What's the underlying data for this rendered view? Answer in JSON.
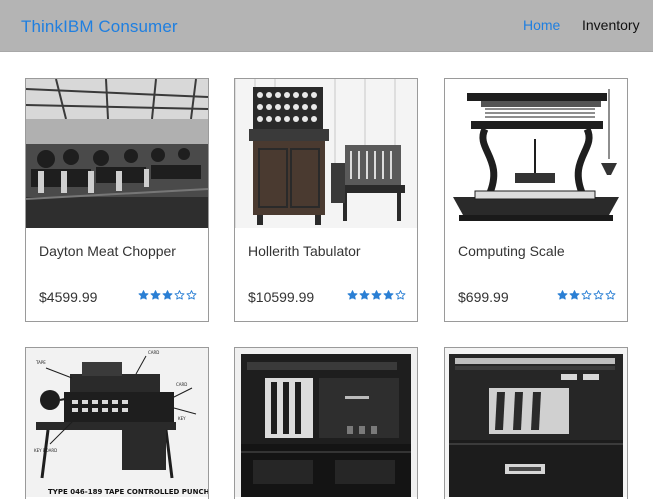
{
  "header": {
    "brand": "ThinkIBM Consumer",
    "nav": [
      {
        "label": "Home",
        "active": true
      },
      {
        "label": "Inventory",
        "active": false
      }
    ]
  },
  "colors": {
    "accent": "#1f7fe0",
    "navbar_bg": "#b4b4b4",
    "star": "#2a7fd4"
  },
  "products": [
    {
      "name": "Dayton Meat Chopper",
      "price": "$4599.99",
      "rating": 3,
      "max_rating": 5,
      "image": "factory-floor-photo"
    },
    {
      "name": "Hollerith Tabulator",
      "price": "$10599.99",
      "rating": 4,
      "max_rating": 5,
      "image": "tabulator-machine-photo"
    },
    {
      "name": "Computing Scale",
      "price": "$699.99",
      "rating": 2,
      "max_rating": 5,
      "image": "computing-scale-illustration"
    },
    {
      "name": "",
      "price": "",
      "rating": 0,
      "max_rating": 5,
      "image": "tape-controlled-punch-photo"
    },
    {
      "name": "",
      "price": "",
      "rating": 0,
      "max_rating": 5,
      "image": "punch-card-machine-photo"
    },
    {
      "name": "",
      "price": "",
      "rating": 0,
      "max_rating": 5,
      "image": "collator-machine-photo"
    }
  ],
  "image_labels": {
    "tape_punch_caption": "TYPE 046-189 TAPE CONTROLLED PUNCH"
  }
}
